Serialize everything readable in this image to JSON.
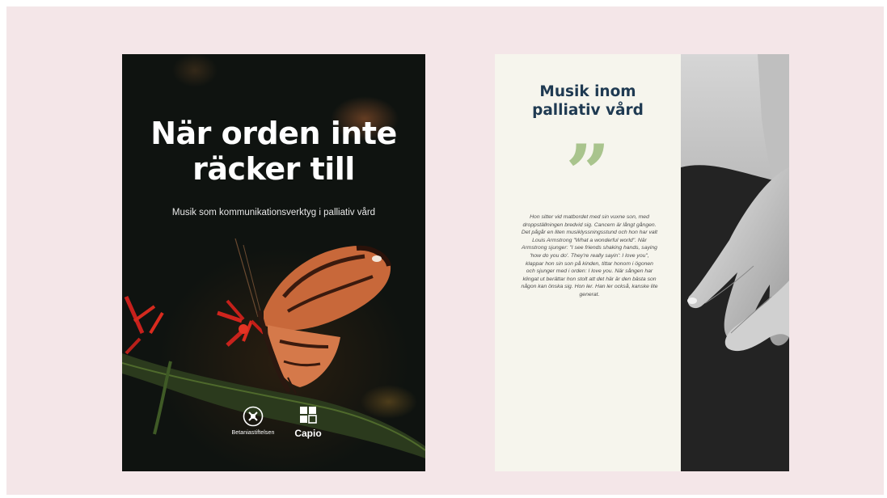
{
  "cover": {
    "title": "När orden inte\nräcker till",
    "subtitle": "Musik som kommunikationsverktyg i palliativ vård",
    "logos": {
      "bs_label": "Betaniastiftelsen",
      "capio_label": "Capio"
    }
  },
  "inner": {
    "title": "Musik inom\npalliativ vård",
    "quote_mark": "”",
    "body": "Hon sitter vid matbordet med sin vuxne son, med droppställningen bredvid sig. Cancern är långt gången. Det pågår en liten musiklyssningsstund och hon har valt Louis Armstrong \"What a wonderful world\". När Armstrong sjunger: \"I see friends shaking hands, saying 'how do you do'. They're really sayin': I love you\", klappar hon sin son på kinden, tittar honom i ögonen och sjunger med i orden: I love you. När sången har klingat ut berättar hon stolt att det här är den bästa son någon kan önska sig. Hon ler. Han ler också, kanske lite generat."
  },
  "colors": {
    "page_background": "#f4e6e8",
    "cover_background": "#0e1210",
    "inner_background": "#f6f5ed",
    "inner_title": "#1f3a52",
    "quote_mark": "#a9c48d"
  }
}
